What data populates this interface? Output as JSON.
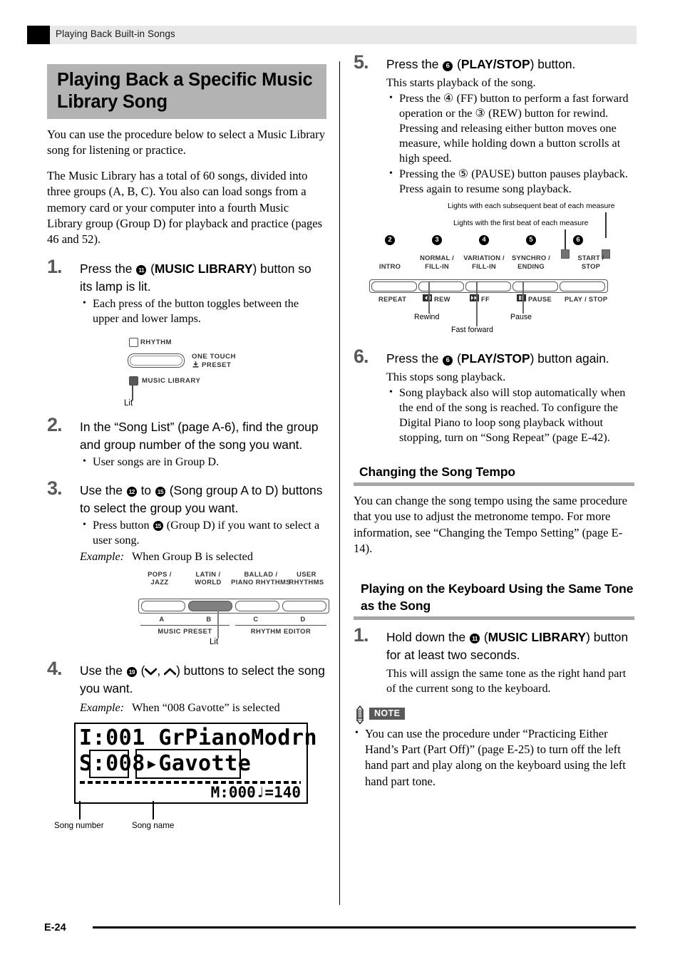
{
  "running_header": {
    "title": "Playing Back Built-in Songs"
  },
  "footer": {
    "page_number": "E-24"
  },
  "left_column": {
    "heading": "Playing Back a Specific Music Library Song",
    "intro_1": "You can use the procedure below to select a Music Library song for listening or practice.",
    "intro_2": "The Music Library has a total of 60 songs, divided into three groups (A, B, C). You also can load songs from a memory card or your computer into a fourth Music Library group (Group D) for playback and practice (pages 46 and 52).",
    "step1": {
      "number": "1.",
      "head_pre": "Press the ",
      "badge": "11",
      "head_mid": " (",
      "head_bold": "MUSIC LIBRARY",
      "head_post": ") button so its lamp is lit.",
      "bullets": [
        "Each press of the button toggles between the upper and lower lamps."
      ]
    },
    "figure_lamp": {
      "rhythm_label": "RHYTHM",
      "one_touch_label_1": "ONE TOUCH",
      "one_touch_label_2": "PRESET",
      "music_library_label": "MUSIC LIBRARY",
      "lit_label": "Lit"
    },
    "step2": {
      "number": "2.",
      "head": "In the “Song List” (page A-6), find the group and group number of the song you want.",
      "bullets": [
        "User songs are in Group D."
      ]
    },
    "step3": {
      "number": "3.",
      "head_pre": "Use the ",
      "badge_a": "12",
      "head_mid": " to ",
      "badge_b": "15",
      "head_post": " (Song group A to D) buttons to select the group you want.",
      "bullet_pre": "Press button ",
      "bullet_badge": "15",
      "bullet_post": " (Group D) if you want to select a user song.",
      "example_label": "Example:",
      "example_text": "When Group B is selected"
    },
    "figure_groups": {
      "captions": [
        "POPS /\nJAZZ",
        "LATIN /\nWORLD",
        "BALLAD /\nPIANO RHYTHMS",
        "USER\nRHYTHMS"
      ],
      "group_letters": [
        "A",
        "B",
        "C",
        "D"
      ],
      "underline_labels": [
        "MUSIC PRESET",
        "RHYTHM EDITOR"
      ],
      "lit_label": "Lit",
      "selected_index": 1
    },
    "step4": {
      "number": "4.",
      "head_pre": "Use the ",
      "badge": "19",
      "head_mid": " (",
      "icon_down": "⌄",
      "icon_up": "⌃",
      "head_post": ") buttons to select the song you want.",
      "example_label": "Example:",
      "example_text": "When “008 Gavotte” is selected"
    },
    "lcd": {
      "line1": "I:001 GrPianoModrn",
      "line2_num": "S:008",
      "line2_arrow": "▸",
      "line2_name": "Gavotte",
      "measure": "M:000",
      "tempo": "♩=140",
      "caption_song_number": "Song number",
      "caption_song_name": "Song name"
    }
  },
  "right_column": {
    "step5": {
      "number": "5.",
      "head_pre": "Press the ",
      "badge": "6",
      "head_mid": " (",
      "head_bold": "PLAY/STOP",
      "head_post": ") button.",
      "sub": "This starts playback of the song.",
      "bullets": [
        "Press the ④ (FF) button to perform a fast forward operation or the ③ (REW) button for rewind. Pressing and releasing either button moves one measure, while holding down a button scrolls at high speed.",
        "Pressing the ⑤ (PAUSE) button pauses playback. Press again to resume song playback."
      ]
    },
    "figure_transport": {
      "note_top": "Lights with each subsequent beat of each measure",
      "note_second": "Lights with the first beat of each measure",
      "badges": [
        "2",
        "3",
        "4",
        "5",
        "6"
      ],
      "badge_labels": [
        "INTRO",
        "NORMAL /\nFILL-IN",
        "VARIATION /\nFILL-IN",
        "SYNCHRO /\nENDING",
        "START /\nSTOP"
      ],
      "button_labels": [
        "REPEAT",
        "REW",
        "FF",
        "PAUSE",
        "PLAY / STOP"
      ],
      "callouts": [
        "Rewind",
        "Fast forward",
        "Pause"
      ]
    },
    "step6": {
      "number": "6.",
      "head_pre": "Press the ",
      "badge": "6",
      "head_mid": " (",
      "head_bold": "PLAY/STOP",
      "head_post": ") button again.",
      "sub": "This stops song playback.",
      "bullets": [
        "Song playback also will stop automatically when the end of the song is reached. To configure the Digital Piano to loop song playback without stopping, turn on “Song Repeat” (page E-42)."
      ]
    },
    "tempo_section": {
      "heading": "Changing the Song Tempo",
      "body": "You can change the song tempo using the same procedure that you use to adjust the metronome tempo. For more information, see “Changing the Tempo Setting” (page E-14)."
    },
    "tone_section": {
      "heading": "Playing on the Keyboard Using the Same Tone as the Song",
      "step1": {
        "number": "1.",
        "head_pre": "Hold down the ",
        "badge": "11",
        "head_mid": " (",
        "head_bold": "MUSIC LIBRARY",
        "head_post": ") button for at least two seconds.",
        "sub": "This will assign the same tone as the right hand part of the current song to the keyboard."
      },
      "note": {
        "badge": "NOTE",
        "bullets": [
          "You can use the procedure under “Practicing Either Hand’s Part (Part Off)” (page E-25) to turn off the left hand part and play along on the keyboard using the left hand part tone."
        ]
      }
    }
  }
}
